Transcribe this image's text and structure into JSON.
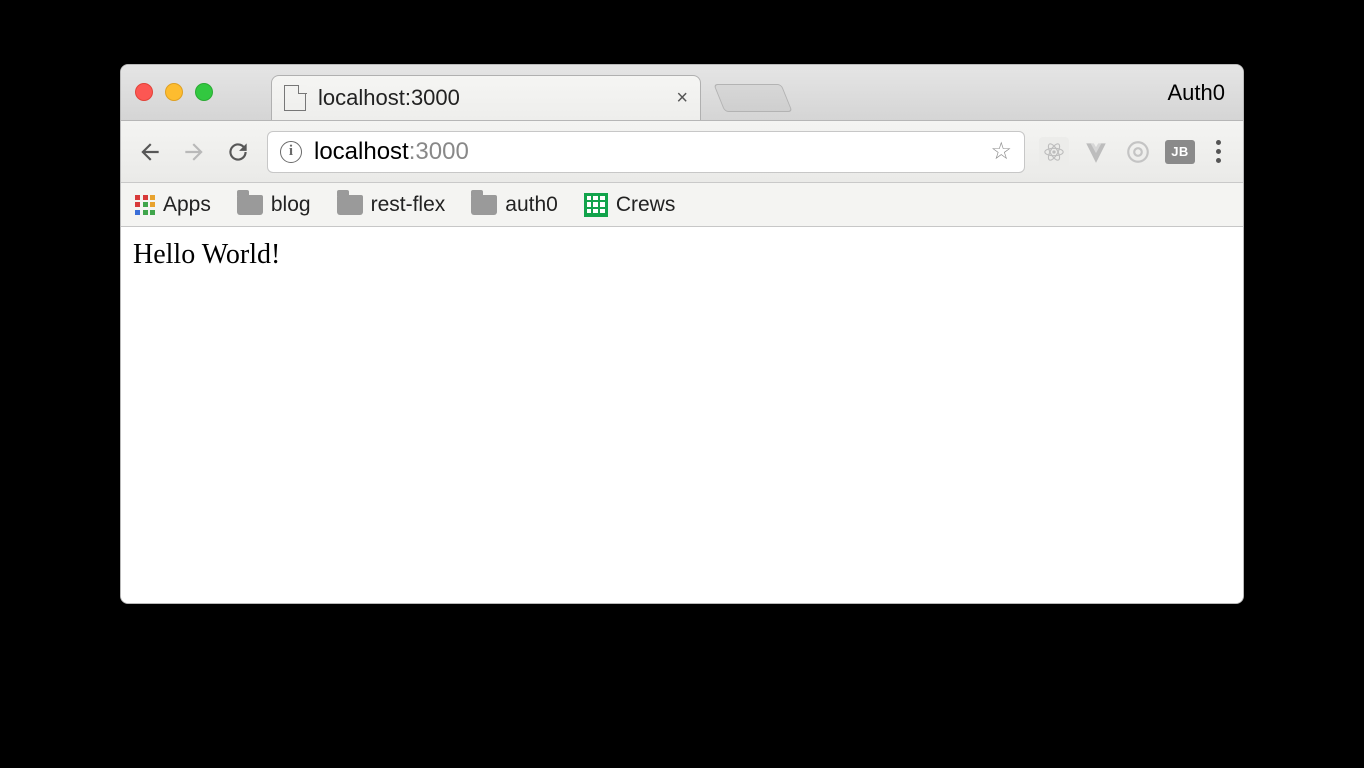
{
  "window": {
    "profile_label": "Auth0"
  },
  "tab": {
    "title": "localhost:3000"
  },
  "address_bar": {
    "host": "localhost",
    "port": ":3000"
  },
  "bookmarks": [
    {
      "label": "Apps",
      "icon": "apps"
    },
    {
      "label": "blog",
      "icon": "folder"
    },
    {
      "label": "rest-flex",
      "icon": "folder"
    },
    {
      "label": "auth0",
      "icon": "folder"
    },
    {
      "label": "Crews",
      "icon": "sheets"
    }
  ],
  "extensions": {
    "jb_label": "JB"
  },
  "page": {
    "body_text": "Hello World!"
  }
}
